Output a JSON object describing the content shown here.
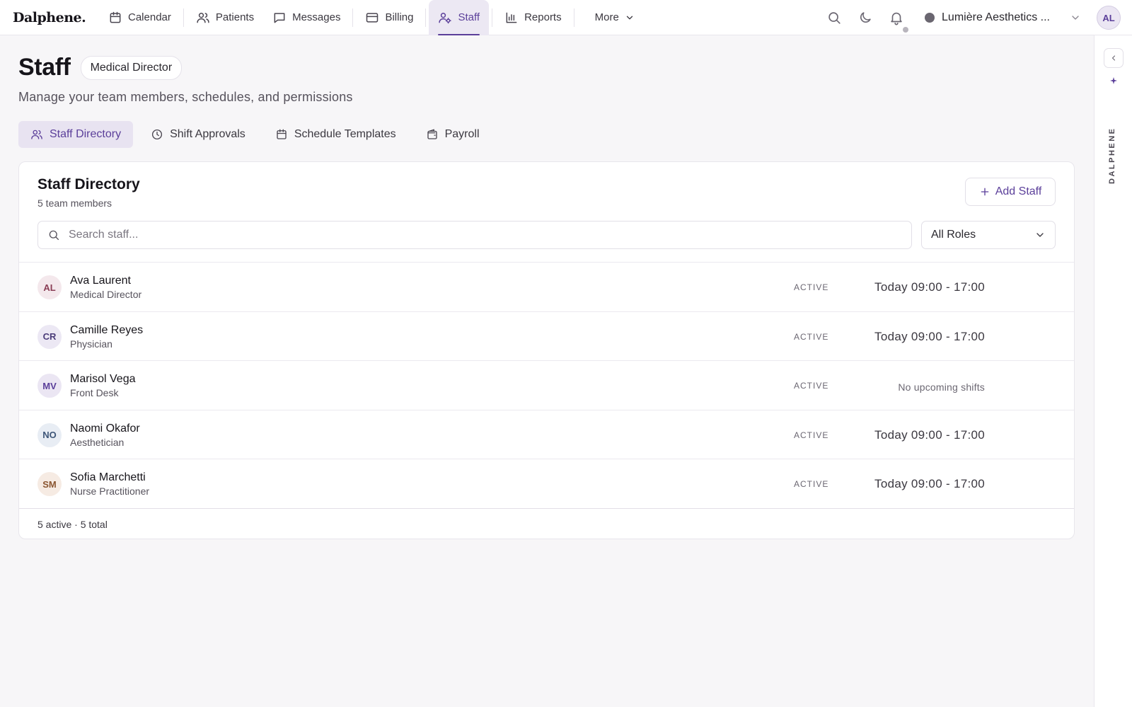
{
  "app": {
    "logo": "Dalphene."
  },
  "nav": {
    "items": [
      {
        "label": "Calendar",
        "icon": "calendar-icon"
      },
      {
        "label": "Patients",
        "icon": "users-icon"
      },
      {
        "label": "Messages",
        "icon": "message-icon"
      },
      {
        "label": "Billing",
        "icon": "card-icon"
      },
      {
        "label": "Staff",
        "icon": "user-gear-icon",
        "active": true
      },
      {
        "label": "Reports",
        "icon": "bar-chart-icon"
      }
    ],
    "more_label": "More"
  },
  "topbar": {
    "clinic_name": "Lumière Aesthetics ...",
    "user_initials": "AL"
  },
  "rail": {
    "brand_text": "DALPHENE"
  },
  "page": {
    "title": "Staff",
    "role_badge": "Medical Director",
    "subtitle": "Manage your team members, schedules, and permissions"
  },
  "tabs": [
    {
      "label": "Staff Directory",
      "icon": "users-icon",
      "active": true
    },
    {
      "label": "Shift Approvals",
      "icon": "clock-icon"
    },
    {
      "label": "Schedule Templates",
      "icon": "calendar-icon"
    },
    {
      "label": "Payroll",
      "icon": "wallet-icon"
    }
  ],
  "directory": {
    "title": "Staff Directory",
    "count_label": "5 team members",
    "add_button_label": "Add Staff",
    "search_placeholder": "Search staff...",
    "role_filter_value": "All Roles",
    "footer": "5 active · 5 total",
    "staff": [
      {
        "initials": "AL",
        "name": "Ava Laurent",
        "role": "Medical Director",
        "status": "ACTIVE",
        "shift": "Today 09:00 - 17:00",
        "avatar_bg": "#f4e8ec",
        "avatar_fg": "#8a3d55"
      },
      {
        "initials": "CR",
        "name": "Camille Reyes",
        "role": "Physician",
        "status": "ACTIVE",
        "shift": "Today 09:00 - 17:00",
        "avatar_bg": "#ece8f4",
        "avatar_fg": "#4b3c7a"
      },
      {
        "initials": "MV",
        "name": "Marisol Vega",
        "role": "Front Desk",
        "status": "ACTIVE",
        "shift": "No upcoming shifts",
        "avatar_bg": "#ebe6f3",
        "avatar_fg": "#5b3f9a"
      },
      {
        "initials": "NO",
        "name": "Naomi Okafor",
        "role": "Aesthetician",
        "status": "ACTIVE",
        "shift": "Today 09:00 - 17:00",
        "avatar_bg": "#e8edf4",
        "avatar_fg": "#3d5578"
      },
      {
        "initials": "SM",
        "name": "Sofia Marchetti",
        "role": "Nurse Practitioner",
        "status": "ACTIVE",
        "shift": "Today 09:00 - 17:00",
        "avatar_bg": "#f6ebe3",
        "avatar_fg": "#8a5530"
      }
    ]
  },
  "colors": {
    "accent": "#5b3f9a",
    "background": "#f7f6f8"
  }
}
